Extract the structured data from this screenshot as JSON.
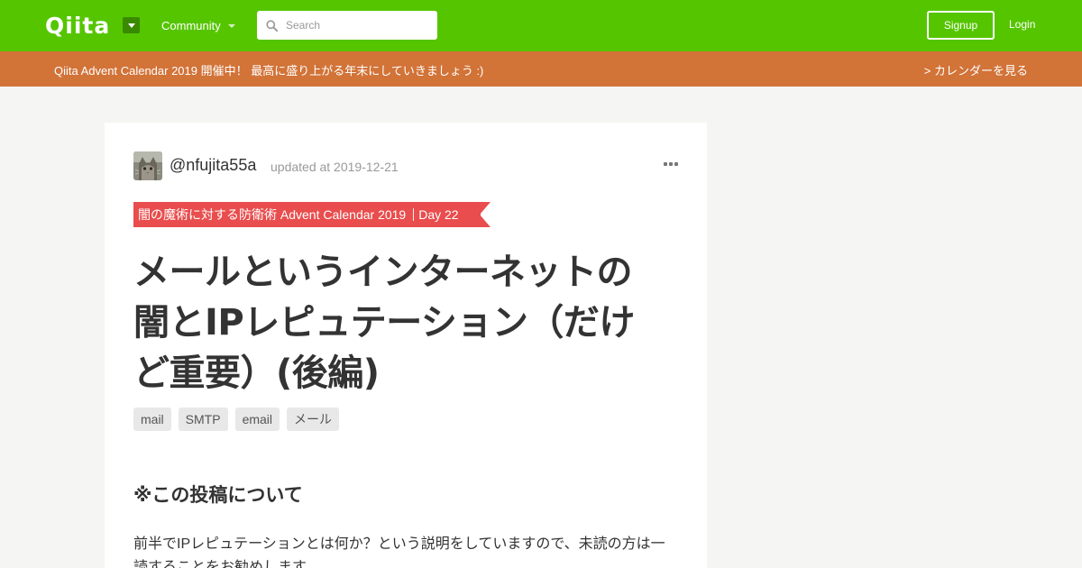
{
  "header": {
    "logo_text": "Qiita",
    "community_label": "Community",
    "search_placeholder": "Search",
    "signup_label": "Signup",
    "login_label": "Login",
    "brand_color": "#55c500"
  },
  "banner": {
    "text": "Qiita Advent Calendar 2019 開催中！ 最高に盛り上がる年末にしていきましょう :)",
    "link_label": "> カレンダーを見る",
    "color": "#d27338"
  },
  "article": {
    "author": "@nfujita55a",
    "updated": "updated at 2019-12-21",
    "calendar": {
      "name": "闇の魔術に対する防衛術 Advent Calendar 2019",
      "day": "Day 22",
      "color": "#e94d4d"
    },
    "title_lines": [
      "メールというインターネットの",
      "闇とIPレピュテーション（だけ",
      "ど重要）(後編)"
    ],
    "tags": [
      "mail",
      "SMTP",
      "email",
      "メール"
    ],
    "section_heading": "※この投稿について",
    "paragraph": "前半でIPレピュテーションとは何か？という説明をしていますので、未読の方は一読することをお勧めします。"
  }
}
